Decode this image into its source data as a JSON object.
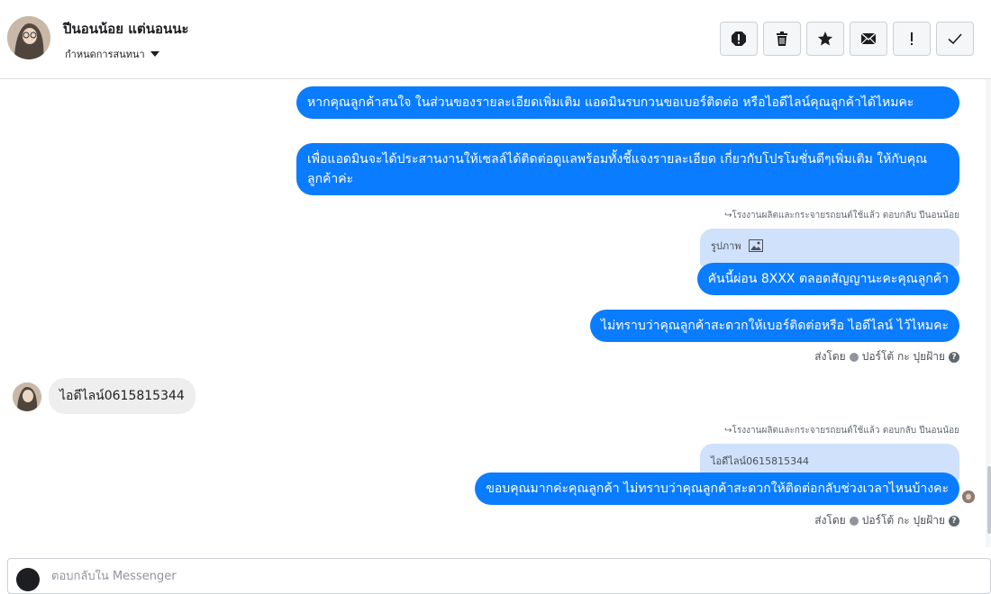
{
  "header": {
    "contact_name": "ปีนอนน้อย แต่นอนนะ",
    "assign_label": "กำหนดการสนทนา",
    "actions": {
      "spam": "spam-icon",
      "delete": "trash-icon",
      "star": "star-icon",
      "unread": "envelope-icon",
      "important": "exclamation-icon",
      "done": "check-icon"
    }
  },
  "messages": {
    "m1": "หากคุณลูกค้าสนใจ ในส่วนของรายละเอียดเพิ่มเติม แอดมินรบกวนขอเบอร์ติดต่อ หรือไอดีไลน์คุณลูกค้าได้ไหมคะ",
    "m2": "เพื่อแอดมินจะได้ประสานงานให้เซลล์ได้ติดต่อดูแลพร้อมทั้งชี้แจงรายละเอียด เกี่ยวกับโปรโมชั่นดีๆเพิ่มเติม ให้กับคุณลูกค้าค่ะ",
    "reply_note_1": "โรงงานผลิตและกระจายรถยนต์ใช้แล้ว ตอบกลับ ปีนอนน้อย",
    "quote_1": "รูปภาพ",
    "m3": "คันนี้ผ่อน 8XXX ตลอดสัญญานะคะคุณลูกค้า",
    "m4": "ไม่ทราบว่าคุณลูกค้าสะดวกให้เบอร์ติดต่อหรือ ไอดีไลน์ ไว้ไหมคะ",
    "sent_by_1": "ส่งโดย",
    "sender_1": "ปอร์โต้ กะ ปุยฝ้าย",
    "incoming_1": "ไอดีไลน์0615815344",
    "reply_note_2": "โรงงานผลิตและกระจายรถยนต์ใช้แล้ว ตอบกลับ ปีนอนน้อย",
    "quote_2": "ไอดีไลน์0615815344",
    "m5": "ขอบคุณมากค่ะคุณลูกค้า ไม่ทราบว่าคุณลูกค้าสะดวกให้ติดต่อกลับช่วงเวลาไหนบ้างคะ",
    "sent_by_2": "ส่งโดย",
    "sender_2": "ปอร์โต้ กะ ปุยฝ้าย"
  },
  "composer": {
    "placeholder": "ตอบกลับใน Messenger"
  },
  "colors": {
    "outgoing_bubble": "#0a7cff",
    "incoming_bubble": "#eeeeee",
    "quoted_bubble": "#cfe1fb"
  }
}
